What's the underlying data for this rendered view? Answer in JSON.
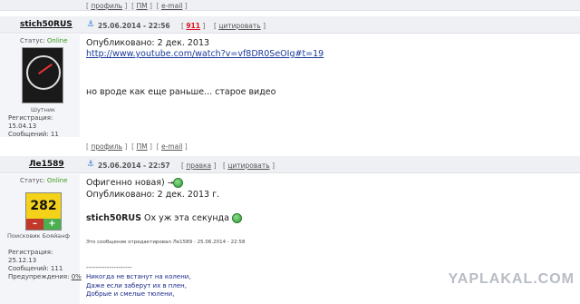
{
  "links": {
    "profile": "профиль",
    "pm": "ПМ",
    "email": "e-mail"
  },
  "post1": {
    "nick": "stich50RUS",
    "date": "25.06.2014 - 22:56",
    "count": "911",
    "quote": "цитировать",
    "status_label": "Статус:",
    "status_value": "Online",
    "rank": "Шутник",
    "reg_label": "Регистрация:",
    "reg_date": "15.04.13",
    "msgs": "Сообщений: 11",
    "line1": "Опубликовано: 2 дек. 2013",
    "link": "http://www.youtube.com/watch?v=vf8DR0SeOIg#t=19",
    "line2": "но вроде как еще раньше... старое видео"
  },
  "post2": {
    "nick": "Ле1589",
    "date": "25.06.2014 - 22:57",
    "edit": "правка",
    "quote": "цитировать",
    "status_label": "Статус:",
    "status_value": "Online",
    "rating": "282",
    "rating_minus": "–",
    "rating_plus": "+",
    "rank": "Поисковик Бояйанф",
    "reg_label": "Регистрация:",
    "reg_date": "25.12.13",
    "msgs": "Сообщений: 111",
    "warn": "Предупреждения:",
    "warn_val": "0%",
    "line1": "Офигенно новая)",
    "line2": "Опубликовано: 2 дек. 2013 г.",
    "quoted_nick": "stich50RUS",
    "quoted_text": "Ох уж эта секунда",
    "edit_note": "Это сообщение отредактировал Ле1589 - 25.06.2014 - 22:58",
    "sep": "--------------------",
    "verse1": "Никогда не встанут на колени,",
    "verse2": "Даже если заберут их в плен,",
    "verse3": "Добрые и смелые тюлени,"
  },
  "watermark": "YAPLAKAL.COM"
}
